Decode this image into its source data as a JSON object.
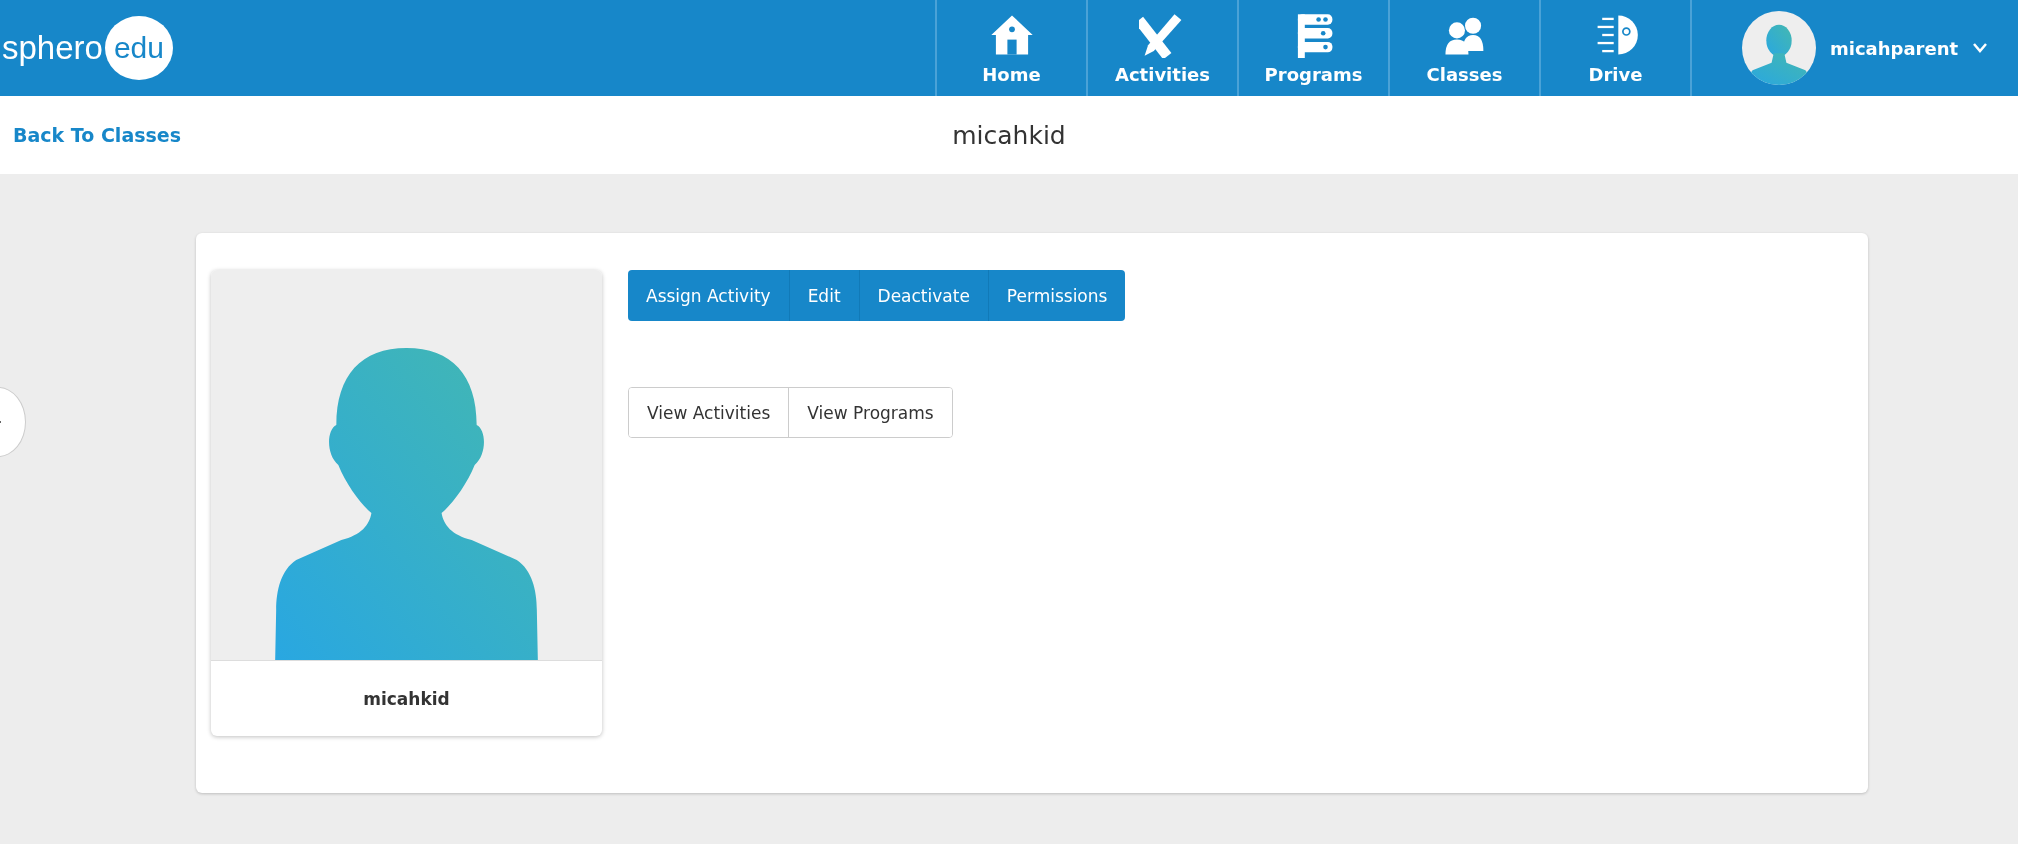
{
  "logo": {
    "word": "sphero",
    "badge": "edu"
  },
  "nav": [
    {
      "label": "Home",
      "kind": "home",
      "selected": false
    },
    {
      "label": "Activities",
      "kind": "activities",
      "selected": false
    },
    {
      "label": "Programs",
      "kind": "programs",
      "selected": false
    },
    {
      "label": "Classes",
      "kind": "classes",
      "selected": false
    },
    {
      "label": "Drive",
      "kind": "drive",
      "selected": false
    }
  ],
  "user": {
    "name": "micahparent"
  },
  "subheader": {
    "back_link": "Back To Classes",
    "title": "micahkid"
  },
  "profile": {
    "name": "micahkid"
  },
  "primary_actions": [
    "Assign Activity",
    "Edit",
    "Deactivate",
    "Permissions"
  ],
  "view_tabs": [
    {
      "label": "View Activities",
      "selected": false
    },
    {
      "label": "View Programs",
      "selected": false
    }
  ]
}
